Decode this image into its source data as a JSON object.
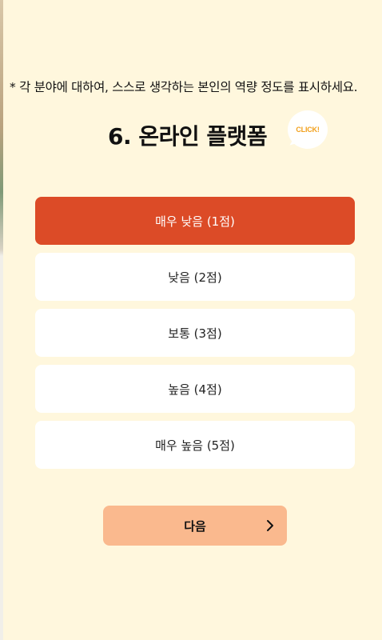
{
  "instruction": "* 각 분야에 대하여, 스스로 생각하는 본인의 역량 정도를 표시하세요.",
  "question": {
    "title": "6. 온라인 플랫폼",
    "click_badge": "CLICK!"
  },
  "options": [
    {
      "label": "매우 낮음 (1점)",
      "selected": true
    },
    {
      "label": "낮음 (2점)",
      "selected": false
    },
    {
      "label": "보통 (3점)",
      "selected": false
    },
    {
      "label": "높음 (4점)",
      "selected": false
    },
    {
      "label": "매우 높음 (5점)",
      "selected": false
    }
  ],
  "next_button": {
    "label": "다음",
    "icon": "chevron-right-icon"
  },
  "colors": {
    "background": "#fff7dd",
    "selected": "#dc4b27",
    "next_button": "#fab98e",
    "badge_text": "#f2a01c"
  }
}
